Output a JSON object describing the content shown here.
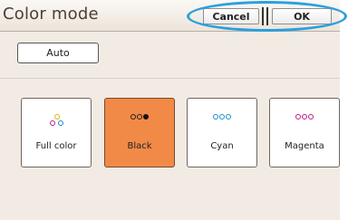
{
  "header": {
    "title": "Color mode",
    "cancel_label": "Cancel",
    "ok_label": "OK"
  },
  "auto_label": "Auto",
  "modes": [
    {
      "label": "Full color",
      "selected": false,
      "dot_colors": [
        "#e0b21b",
        "#c21e8a",
        "#1a8fc9"
      ]
    },
    {
      "label": "Black",
      "selected": true,
      "dot_colors": [
        "#ffffff",
        "#ffffff",
        "#111111"
      ]
    },
    {
      "label": "Cyan",
      "selected": false,
      "dot_colors": [
        "#1a8fc9",
        "#1a8fc9",
        "#1a8fc9"
      ]
    },
    {
      "label": "Magenta",
      "selected": false,
      "dot_colors": [
        "#c21e8a",
        "#c21e8a",
        "#c21e8a"
      ]
    }
  ],
  "colors": {
    "selected_bg": "#f28a47",
    "highlight": "#2a9fe0",
    "panel_bg": "#f1ebe4"
  }
}
